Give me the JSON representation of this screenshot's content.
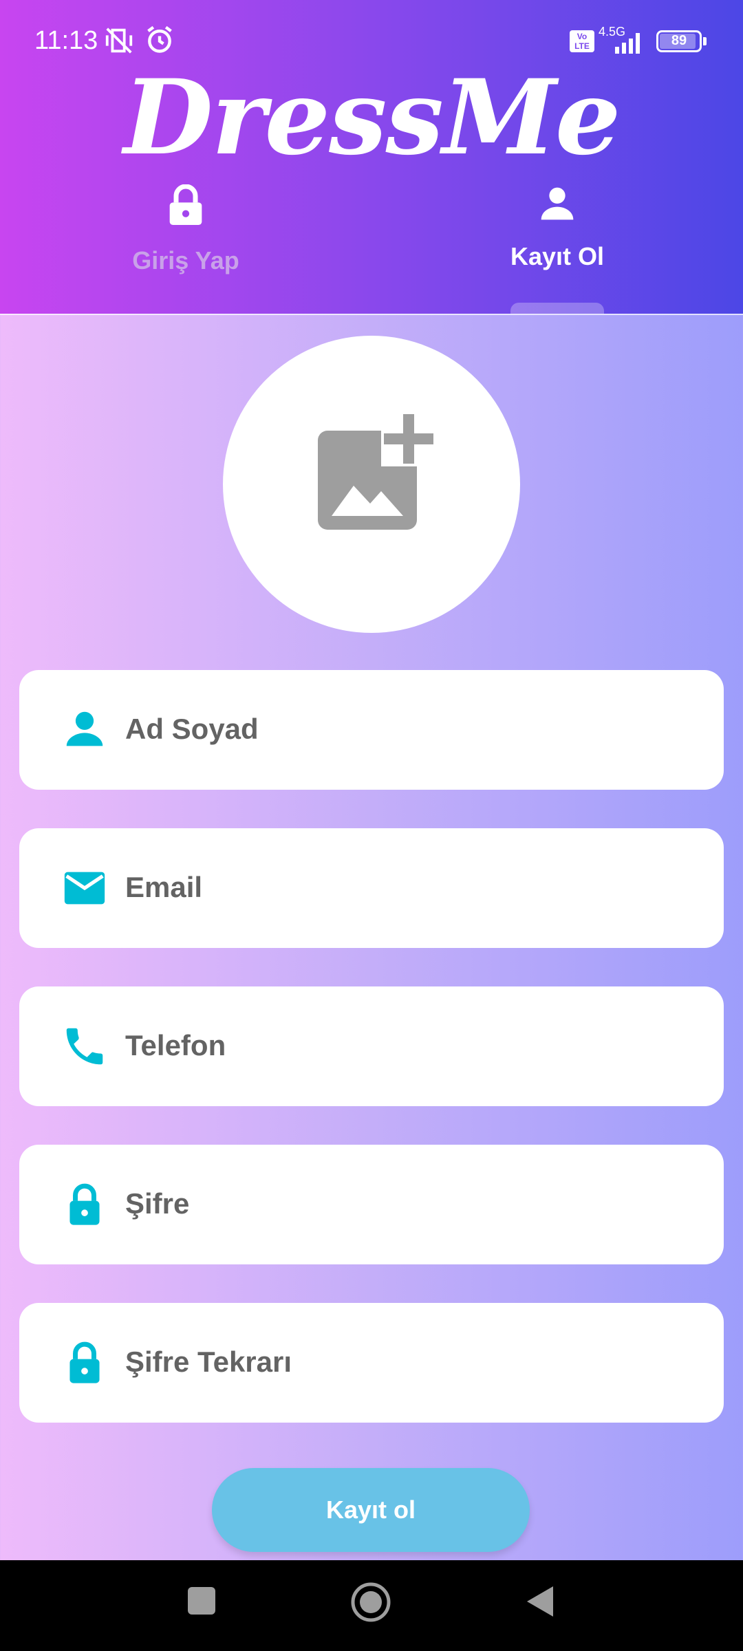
{
  "status_bar": {
    "time": "11:13",
    "network": "4.5G",
    "volte": "Vo LTE",
    "battery": "89"
  },
  "app": {
    "title": "DressMe"
  },
  "tabs": [
    {
      "label": "Giriş Yap",
      "icon": "lock-icon",
      "active": false
    },
    {
      "label": "Kayıt Ol",
      "icon": "person-icon",
      "active": true
    }
  ],
  "avatar": {
    "icon": "add-photo-icon"
  },
  "form": {
    "fields": [
      {
        "placeholder": "Ad Soyad",
        "icon": "person-icon"
      },
      {
        "placeholder": "Email",
        "icon": "mail-icon"
      },
      {
        "placeholder": "Telefon",
        "icon": "phone-icon"
      },
      {
        "placeholder": "Şifre",
        "icon": "lock-icon"
      },
      {
        "placeholder": "Şifre Tekrarı",
        "icon": "lock-icon"
      }
    ],
    "submit_label": "Kayıt ol"
  },
  "colors": {
    "accent_icon": "#00bcd4",
    "submit_button": "#68c2e7",
    "header_start": "#c845f0",
    "header_end": "#4c47e6"
  },
  "nav_bar": [
    "recent-apps-button",
    "home-button",
    "back-button"
  ]
}
